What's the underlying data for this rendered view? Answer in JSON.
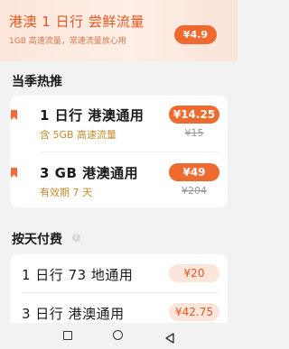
{
  "banner": {
    "title": "港澳 1 日行  尝鲜流量",
    "subtitle": "1GB 高速流量，常速流量放心用",
    "price": "¥4.9"
  },
  "hot_section": {
    "title": "当季热推",
    "items": [
      {
        "name": "1 日行  港澳通用",
        "desc": "含 5GB 高速流量",
        "price": "¥14.25",
        "orig_price": "¥15"
      },
      {
        "name": "3 GB 港澳通用",
        "desc": "有效期 7 天",
        "price": "¥49",
        "orig_price": "¥204"
      }
    ]
  },
  "daily_section": {
    "title": "按天付费",
    "info_glyph": "i",
    "items": [
      {
        "name": "1 日行  73 地通用",
        "price": "¥20"
      },
      {
        "name": "3 日行  港澳通用",
        "price": "¥42.75"
      }
    ]
  },
  "navbar": {
    "icons": [
      "recent-apps-icon",
      "home-icon",
      "back-icon"
    ]
  },
  "colors": {
    "accent": "#ee6a2e",
    "accent_light": "#fce5db",
    "desc_gold": "#c48a2a"
  }
}
